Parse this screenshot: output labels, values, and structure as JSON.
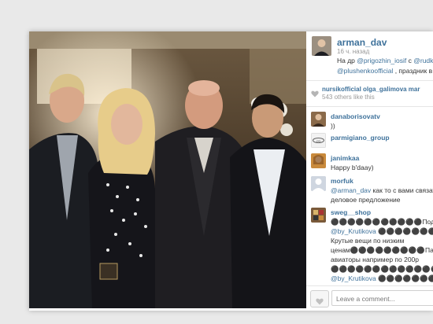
{
  "post": {
    "username": "arman_dav",
    "time": "16 ч. назад",
    "caption_prefix": "На др ",
    "caption_mention1": "@prigozhin_iosif",
    "caption_mid": " с ",
    "caption_mention2": "@rudkov",
    "caption_mention3": "@plushenkoofficial",
    "caption_suffix": " , праздник в с"
  },
  "likes": {
    "likers": "nursikofficial  olga_galimova  mar",
    "others": "543 others like this"
  },
  "comments": [
    {
      "username": "danaborisovatv",
      "lines": [
        "))"
      ],
      "avatar_color": "#8a6a4a"
    },
    {
      "username": "parmigiano_group",
      "lines": [],
      "avatar_color": "#f2f2f2"
    },
    {
      "username": "janimkaa",
      "lines": [
        "Happy b'daay)"
      ],
      "avatar_color": "#c98a3c"
    },
    {
      "username": "morfuk",
      "lines": [
        "как то с вами связать",
        "деловое предложение"
      ],
      "mention": "@arman_dav",
      "avatar_color": "#cfd6e0"
    },
    {
      "username": "sweg__shop",
      "lines": [
        "⚫⚫⚫⚫⚫⚫⚫⚫⚫⚫⚫Подписыва",
        "@by_Krutikova ⚫⚫⚫⚫⚫⚫⚫⚫⚫⚫",
        "Крутые вещи по низким",
        "ценам⚫⚫⚫⚫⚫⚫⚫⚫⚫Панел",
        "авиаторы например по 200р",
        "⚫⚫⚫⚫⚫⚫⚫⚫⚫⚫⚫⚫⚫⚫⚫⚫",
        "@by_Krutikova ⚫⚫⚫⚫⚫⚫⚫⚫⚫⚫"
      ],
      "avatar_color": "#7a5a3a"
    }
  ],
  "footer": {
    "comment_placeholder": "Leave a comment..."
  },
  "colors": {
    "link": "#3f729b",
    "text": "#333333",
    "muted": "#999999",
    "background": "#e9e9e9"
  },
  "icons": [
    "heart-icon",
    "like-heart-icon"
  ]
}
